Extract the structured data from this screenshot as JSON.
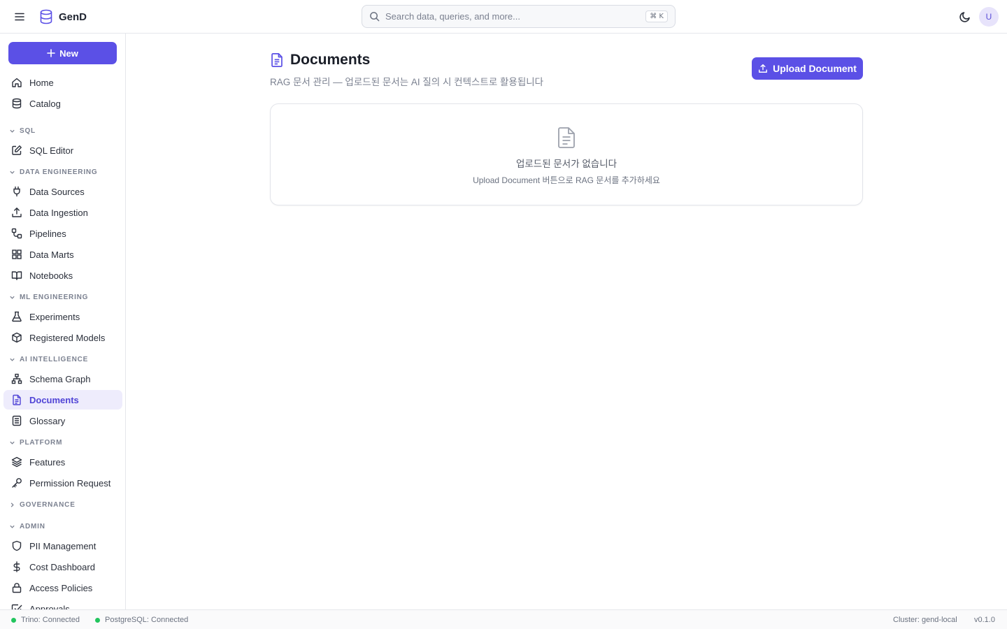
{
  "app": {
    "name": "GenD",
    "user_initial": "U"
  },
  "search": {
    "placeholder": "Search data, queries, and more...",
    "shortcut": "⌘ K"
  },
  "sidebar": {
    "new_label": "New",
    "top_items": [
      {
        "label": "Home",
        "icon": "home-icon"
      },
      {
        "label": "Catalog",
        "icon": "database-icon"
      }
    ],
    "sections": {
      "sql": {
        "label": "SQL",
        "expanded": true,
        "items": [
          {
            "label": "SQL Editor",
            "icon": "edit-icon"
          }
        ]
      },
      "data_engineering": {
        "label": "DATA ENGINEERING",
        "expanded": true,
        "items": [
          {
            "label": "Data Sources",
            "icon": "plug-icon"
          },
          {
            "label": "Data Ingestion",
            "icon": "upload-icon"
          },
          {
            "label": "Pipelines",
            "icon": "workflow-icon"
          },
          {
            "label": "Data Marts",
            "icon": "grid-icon"
          },
          {
            "label": "Notebooks",
            "icon": "book-icon"
          }
        ]
      },
      "ml_engineering": {
        "label": "ML ENGINEERING",
        "expanded": true,
        "items": [
          {
            "label": "Experiments",
            "icon": "flask-icon"
          },
          {
            "label": "Registered Models",
            "icon": "box-icon"
          }
        ]
      },
      "ai_intelligence": {
        "label": "AI INTELLIGENCE",
        "expanded": true,
        "items": [
          {
            "label": "Schema Graph",
            "icon": "network-icon"
          },
          {
            "label": "Documents",
            "icon": "document-icon",
            "active": true
          },
          {
            "label": "Glossary",
            "icon": "glossary-icon"
          }
        ]
      },
      "platform": {
        "label": "PLATFORM",
        "expanded": true,
        "items": [
          {
            "label": "Features",
            "icon": "layers-icon"
          },
          {
            "label": "Permission Request",
            "icon": "key-icon"
          }
        ]
      },
      "governance": {
        "label": "GOVERNANCE",
        "expanded": false,
        "items": []
      },
      "admin": {
        "label": "ADMIN",
        "expanded": true,
        "items": [
          {
            "label": "PII Management",
            "icon": "shield-icon"
          },
          {
            "label": "Cost Dashboard",
            "icon": "dollar-icon"
          },
          {
            "label": "Access Policies",
            "icon": "lock-icon"
          },
          {
            "label": "Approvals",
            "icon": "check-square-icon"
          }
        ]
      }
    }
  },
  "page": {
    "title": "Documents",
    "subtitle": "RAG 문서 관리 — 업로드된 문서는 AI 질의 시 컨텍스트로 활용됩니다",
    "upload_label": "Upload Document",
    "empty_title": "업로드된 문서가 없습니다",
    "empty_desc": "Upload Document 버튼으로 RAG 문서를 추가하세요"
  },
  "status": {
    "trino": "Trino: Connected",
    "postgres": "PostgreSQL: Connected",
    "cluster": "Cluster: gend-local",
    "version": "v0.1.0",
    "connected_color": "#22c55e"
  },
  "colors": {
    "accent": "#5b50e6",
    "active_bg": "#eeecfc"
  }
}
